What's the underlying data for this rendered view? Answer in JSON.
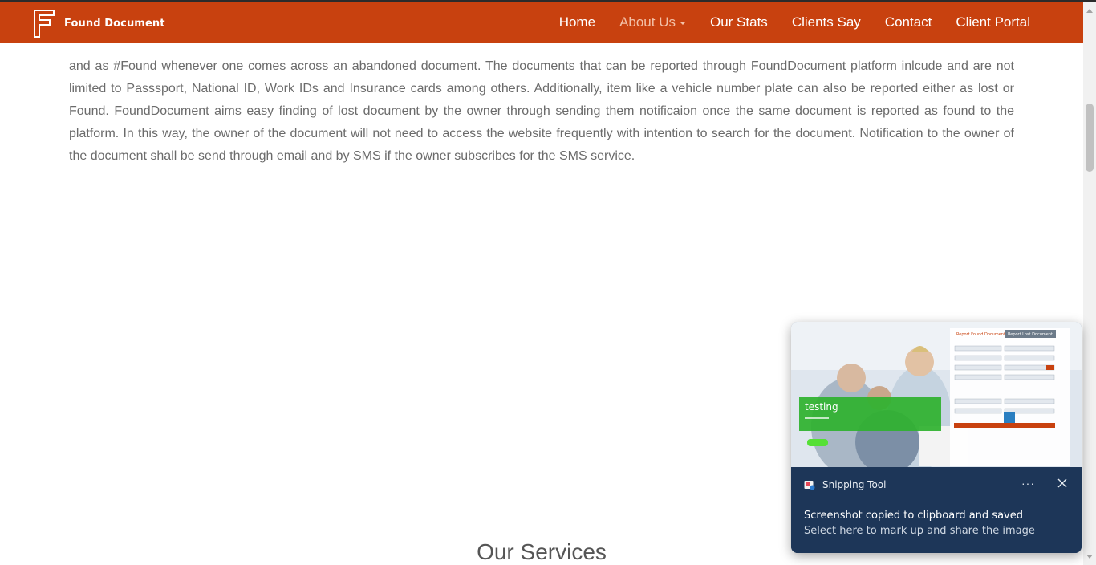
{
  "navbar": {
    "brand": "Found Document",
    "items": [
      {
        "label": "Home",
        "active": false
      },
      {
        "label": "About Us",
        "active": true,
        "dropdown": true
      },
      {
        "label": "Our Stats",
        "active": false
      },
      {
        "label": "Clients Say",
        "active": false
      },
      {
        "label": "Contact",
        "active": false
      },
      {
        "label": "Client Portal",
        "active": false
      }
    ]
  },
  "about": {
    "paragraph": "and as #Found whenever one comes across an abandoned document. The documents that can be reported through FoundDocument platform inlcude and are not limited to Passsport, National ID, Work IDs and Insurance cards among others. Additionally, item like a vehicle number plate can also be reported either as lost or Found. FoundDocument aims easy finding of lost document by the owner through sending them notificaion once the same document is reported as found to the platform. In this way, the owner of the document will not need to access the website frequently with intention to search for the document. Notification to the owner of the document shall be send through email and by SMS if the owner subscribes for the SMS service."
  },
  "services": {
    "title": "Our Services"
  },
  "toast": {
    "app_name": "Snipping Tool",
    "more_label": "···",
    "title": "Screenshot copied to clipboard and saved",
    "subtitle": "Select here to mark up and share the image",
    "preview": {
      "banner_text": "testing",
      "form_tab_found": "Report Found Document",
      "form_tab_lost": "Report Lost Document"
    }
  },
  "colors": {
    "navbar_bg": "#c8410f",
    "nav_active": "#f3c1a8",
    "body_text": "#6b6b6b",
    "toast_bg": "#1d3658"
  }
}
